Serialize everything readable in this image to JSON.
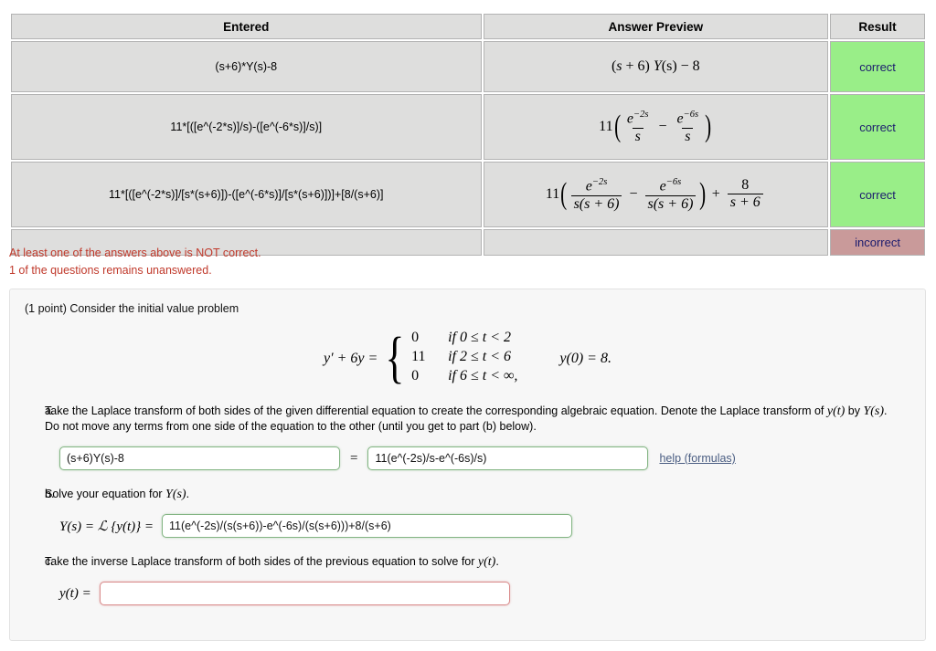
{
  "results_table": {
    "headers": [
      "Entered",
      "Answer Preview",
      "Result"
    ],
    "rows": [
      {
        "entered": "(s+6)*Y(s)-8",
        "preview_plain": "(s + 6) Y(s) − 8",
        "result": "correct"
      },
      {
        "entered": "11*[([e^(-2*s)]/s)-([e^(-6*s)]/s)]",
        "preview_plain": "11( e^(-2s)/s − e^(-6s)/s )",
        "result": "correct"
      },
      {
        "entered": "11*[([e^(-2*s)]/[s*(s+6)])-([e^(-6*s)]/[s*(s+6)])]+[8/(s+6)]",
        "preview_plain": "11( e^(-2s)/(s(s+6)) − e^(-6s)/(s(s+6)) ) + 8/(s+6)",
        "result": "correct"
      },
      {
        "entered": "",
        "preview_plain": "",
        "result": "incorrect"
      }
    ],
    "preview_parts": {
      "row1": {
        "lead": "(",
        "s": "s",
        "plus6": "+ 6)",
        "Y": "Y",
        "sarg": "(s)",
        "minus8": "− 8"
      },
      "row2": {
        "coef": "11",
        "num1": "e",
        "exp1": "−2s",
        "den1": "s",
        "op": "−",
        "num2": "e",
        "exp2": "−6s",
        "den2": "s"
      },
      "row3": {
        "coef": "11",
        "num1": "e",
        "exp1": "−2s",
        "den1": "s(s + 6)",
        "op": "−",
        "num2": "e",
        "exp2": "−6s",
        "den2": "s(s + 6)",
        "plus": "+",
        "num3": "8",
        "den3": "s + 6"
      }
    }
  },
  "warnings": {
    "line1": "At least one of the answers above is NOT correct.",
    "line2": "1 of the questions remains unanswered.",
    "color": "#c0392b"
  },
  "problem": {
    "intro": "(1 point) Consider the initial value problem",
    "equation": {
      "lhs": "y′ + 6y =",
      "cases": [
        {
          "value": "0",
          "condition": "if 0 ≤ t < 2"
        },
        {
          "value": "11",
          "condition": "if 2 ≤ t < 6"
        },
        {
          "value": "0",
          "condition": "if 6 ≤ t < ∞,"
        }
      ],
      "initial_condition": "y(0) = 8."
    },
    "parts": [
      {
        "label": "a.",
        "text_1": "Take the Laplace transform of both sides of the given differential equation to create the corresponding algebraic equation. Denote the Laplace transform of ",
        "text_yt": "y(t)",
        "text_2": " by ",
        "text_Ys": "Y(s)",
        "text_3": ". Do not move any terms from one side of the equation to the other (until you get to part (b) below)."
      },
      {
        "label": "b.",
        "text_1": "Solve your equation for ",
        "text_Ys": "Y(s)",
        "text_2": "."
      },
      {
        "label": "c.",
        "text_1": "Take the inverse Laplace transform of both sides of the previous equation to solve for ",
        "text_yt": "y(t)",
        "text_2": "."
      }
    ],
    "answers": {
      "a_left_value": "(s+6)Y(s)-8",
      "a_equals": "=",
      "a_right_value": "11(e^(-2s)/s-e^(-6s)/s)",
      "a_help_label": "help (formulas)",
      "b_lhs": "Y(s) = ℒ {y(t)}  =",
      "b_value": "11(e^(-2s)/(s(s+6))-e^(-6s)/(s(s+6)))+8/(s+6)",
      "c_lhs": "y(t) =",
      "c_value": "",
      "c_placeholder": ""
    }
  },
  "colors": {
    "correct_bg": "#99ee88",
    "incorrect_bg": "#c99a9a",
    "result_text": "#1b1b6e",
    "table_cell_bg": "#dededd",
    "warning_text": "#c0392b",
    "input_ok_border": "#84b584",
    "input_err_border": "#d98a8a",
    "help_link": "#4a5d82"
  }
}
